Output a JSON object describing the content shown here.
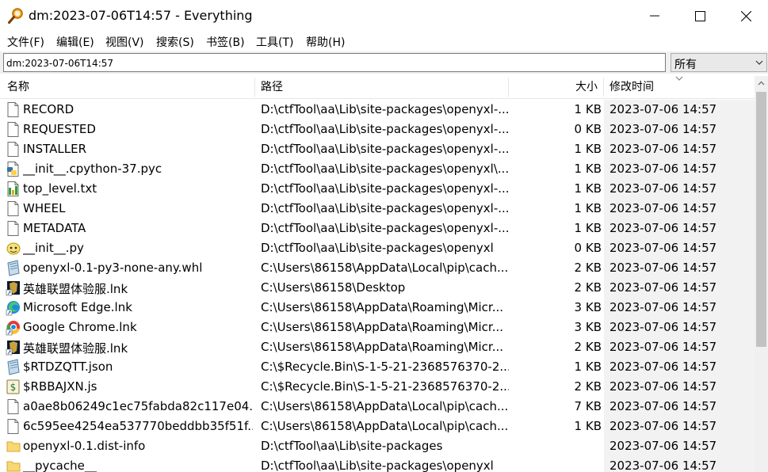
{
  "window": {
    "title": "dm:2023-07-06T14:57 - Everything"
  },
  "menu": [
    "文件(F)",
    "编辑(E)",
    "视图(V)",
    "搜索(S)",
    "书签(B)",
    "工具(T)",
    "帮助(H)"
  ],
  "search": {
    "value": "dm:2023-07-06T14:57",
    "filter": "所有"
  },
  "columns": {
    "name": "名称",
    "path": "路径",
    "size": "大小",
    "modified": "修改时间"
  },
  "rows": [
    {
      "name": "RECORD",
      "path": "D:\\ctfTool\\aa\\Lib\\site-packages\\openyxl-...",
      "size": "1 KB",
      "modified": "2023-07-06 14:57",
      "icon": "file-icon"
    },
    {
      "name": "REQUESTED",
      "path": "D:\\ctfTool\\aa\\Lib\\site-packages\\openyxl-...",
      "size": "0 KB",
      "modified": "2023-07-06 14:57",
      "icon": "file-icon"
    },
    {
      "name": "INSTALLER",
      "path": "D:\\ctfTool\\aa\\Lib\\site-packages\\openyxl-...",
      "size": "1 KB",
      "modified": "2023-07-06 14:57",
      "icon": "file-icon"
    },
    {
      "name": "__init__.cpython-37.pyc",
      "path": "D:\\ctfTool\\aa\\Lib\\site-packages\\openyxl\\...",
      "size": "1 KB",
      "modified": "2023-07-06 14:57",
      "icon": "python-compiled-icon"
    },
    {
      "name": "top_level.txt",
      "path": "D:\\ctfTool\\aa\\Lib\\site-packages\\openyxl-...",
      "size": "1 KB",
      "modified": "2023-07-06 14:57",
      "icon": "text-file-icon"
    },
    {
      "name": "WHEEL",
      "path": "D:\\ctfTool\\aa\\Lib\\site-packages\\openyxl-...",
      "size": "1 KB",
      "modified": "2023-07-06 14:57",
      "icon": "file-icon"
    },
    {
      "name": "METADATA",
      "path": "D:\\ctfTool\\aa\\Lib\\site-packages\\openyxl-...",
      "size": "1 KB",
      "modified": "2023-07-06 14:57",
      "icon": "file-icon"
    },
    {
      "name": "__init__.py",
      "path": "D:\\ctfTool\\aa\\Lib\\site-packages\\openyxl",
      "size": "0 KB",
      "modified": "2023-07-06 14:57",
      "icon": "python-script-icon"
    },
    {
      "name": "openyxl-0.1-py3-none-any.whl",
      "path": "C:\\Users\\86158\\AppData\\Local\\pip\\cach...",
      "size": "2 KB",
      "modified": "2023-07-06 14:57",
      "icon": "archive-icon"
    },
    {
      "name": "英雄联盟体验服.lnk",
      "path": "C:\\Users\\86158\\Desktop",
      "size": "2 KB",
      "modified": "2023-07-06 14:57",
      "icon": "game-shortcut-icon"
    },
    {
      "name": "Microsoft Edge.lnk",
      "path": "C:\\Users\\86158\\AppData\\Roaming\\Micr...",
      "size": "3 KB",
      "modified": "2023-07-06 14:57",
      "icon": "edge-icon"
    },
    {
      "name": "Google Chrome.lnk",
      "path": "C:\\Users\\86158\\AppData\\Roaming\\Micr...",
      "size": "3 KB",
      "modified": "2023-07-06 14:57",
      "icon": "chrome-icon"
    },
    {
      "name": "英雄联盟体验服.lnk",
      "path": "C:\\Users\\86158\\AppData\\Roaming\\Micr...",
      "size": "2 KB",
      "modified": "2023-07-06 14:57",
      "icon": "game-shortcut-icon"
    },
    {
      "name": "$RTDZQTT.json",
      "path": "C:\\$Recycle.Bin\\S-1-5-21-2368576370-2...",
      "size": "1 KB",
      "modified": "2023-07-06 14:57",
      "icon": "archive-icon"
    },
    {
      "name": "$RBBAJXN.js",
      "path": "C:\\$Recycle.Bin\\S-1-5-21-2368576370-2...",
      "size": "2 KB",
      "modified": "2023-07-06 14:57",
      "icon": "script-icon"
    },
    {
      "name": "a0ae8b06249c1ec75fabda82c117e04...",
      "path": "C:\\Users\\86158\\AppData\\Local\\pip\\cach...",
      "size": "7 KB",
      "modified": "2023-07-06 14:57",
      "icon": "file-icon"
    },
    {
      "name": "6c595ee4254ea537770beddbb35f51f...",
      "path": "C:\\Users\\86158\\AppData\\Local\\pip\\cach...",
      "size": "1 KB",
      "modified": "2023-07-06 14:57",
      "icon": "file-icon"
    },
    {
      "name": "openyxl-0.1.dist-info",
      "path": "D:\\ctfTool\\aa\\Lib\\site-packages",
      "size": "",
      "modified": "2023-07-06 14:57",
      "icon": "folder-icon"
    },
    {
      "name": "__pycache__",
      "path": "D:\\ctfTool\\aa\\Lib\\site-packages\\openyxl",
      "size": "",
      "modified": "2023-07-06 14:57",
      "icon": "folder-icon"
    }
  ]
}
